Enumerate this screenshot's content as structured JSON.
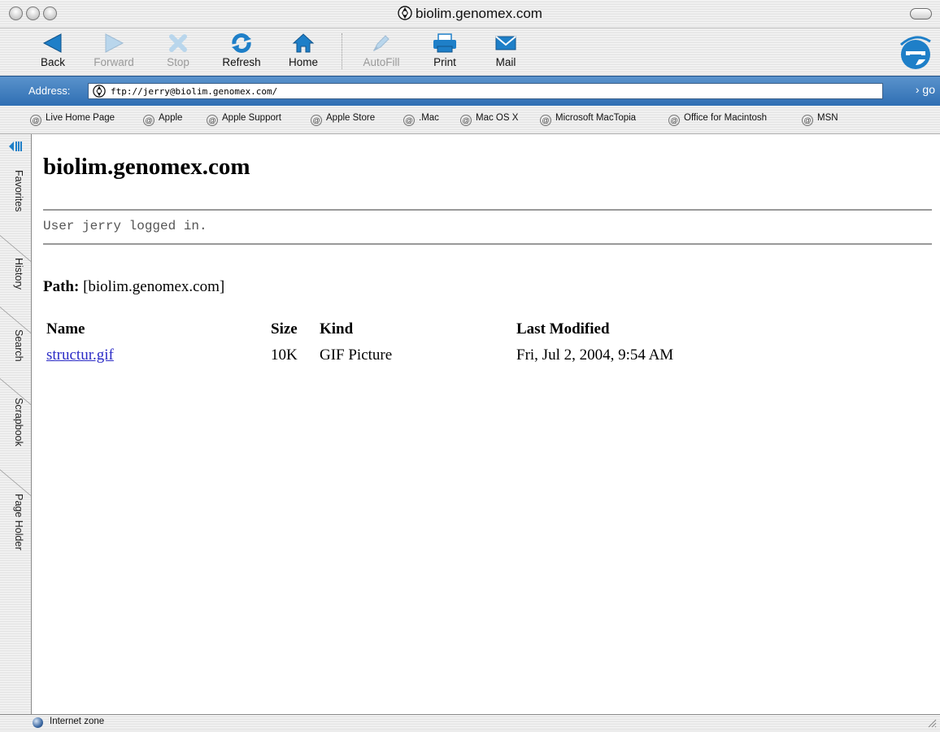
{
  "window": {
    "title": "biolim.genomex.com"
  },
  "toolbar": {
    "buttons": [
      {
        "label": "Back",
        "icon": "back-arrow-icon",
        "enabled": true
      },
      {
        "label": "Forward",
        "icon": "forward-arrow-icon",
        "enabled": false
      },
      {
        "label": "Stop",
        "icon": "stop-x-icon",
        "enabled": false
      },
      {
        "label": "Refresh",
        "icon": "refresh-icon",
        "enabled": true
      },
      {
        "label": "Home",
        "icon": "home-icon",
        "enabled": true
      },
      {
        "label": "AutoFill",
        "icon": "autofill-icon",
        "enabled": false
      },
      {
        "label": "Print",
        "icon": "printer-icon",
        "enabled": true
      },
      {
        "label": "Mail",
        "icon": "mail-icon",
        "enabled": true
      }
    ]
  },
  "address": {
    "label": "Address:",
    "value": "ftp://jerry@biolim.genomex.com/",
    "go_label": "go"
  },
  "favorites": [
    "Live Home Page",
    "Apple",
    "Apple Support",
    "Apple Store",
    ".Mac",
    "Mac OS X",
    "Microsoft MacTopia",
    "Office for Macintosh",
    "MSN"
  ],
  "sidebar_tabs": [
    "Favorites",
    "History",
    "Search",
    "Scrapbook",
    "Page Holder"
  ],
  "content": {
    "heading": "biolim.genomex.com",
    "login_message": "User jerry logged in.",
    "path_label": "Path:",
    "path_value": "[biolim.genomex.com]",
    "columns": [
      "Name",
      "Size",
      "Kind",
      "Last Modified"
    ],
    "files": [
      {
        "name": "structur.gif",
        "size": "10K",
        "kind": "GIF Picture",
        "modified": "Fri, Jul 2, 2004, 9:54 AM"
      }
    ]
  },
  "status": {
    "zone": "Internet zone"
  },
  "colors": {
    "address_bar": "#2f6fb3",
    "link": "#2a2ac6",
    "toolbar_icon": "#1e7fc8"
  }
}
